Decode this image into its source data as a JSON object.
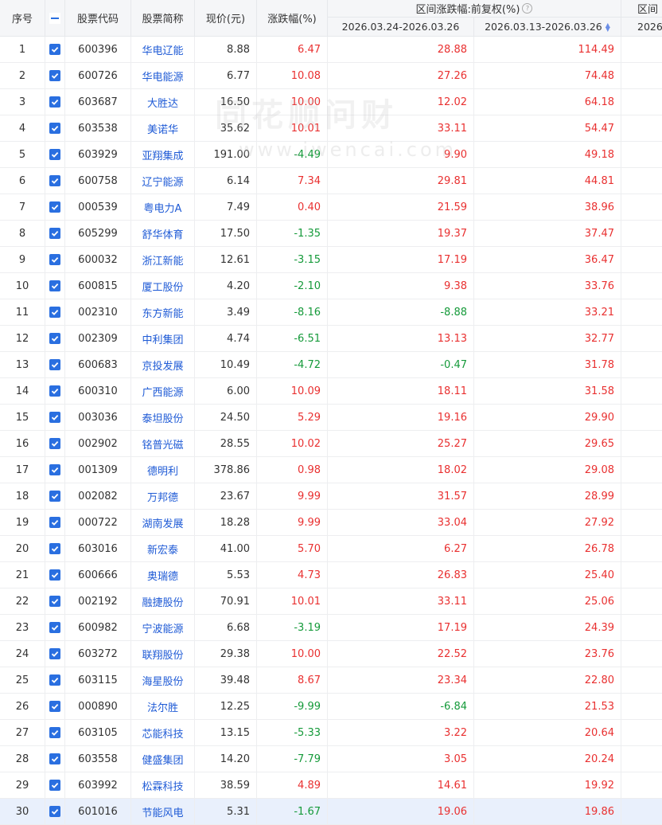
{
  "header": {
    "seq": "序号",
    "code": "股票代码",
    "name": "股票简称",
    "price": "现价(元)",
    "chg": "涨跌幅(%)",
    "group": "区间涨跌幅:前复权(%)",
    "range1": "2026.03.24-2026.03.26",
    "range2": "2026.03.13-2026.03.26",
    "group_cut": "区间",
    "range_cut": "2026"
  },
  "watermark": {
    "cn": "同花顺问财",
    "en": "www.iwencai.com"
  },
  "rows": [
    {
      "seq": "1",
      "code": "600396",
      "name": "华电辽能",
      "price": "8.88",
      "chg": "6.47",
      "r1": "28.88",
      "r2": "114.49"
    },
    {
      "seq": "2",
      "code": "600726",
      "name": "华电能源",
      "price": "6.77",
      "chg": "10.08",
      "r1": "27.26",
      "r2": "74.48"
    },
    {
      "seq": "3",
      "code": "603687",
      "name": "大胜达",
      "price": "16.50",
      "chg": "10.00",
      "r1": "12.02",
      "r2": "64.18"
    },
    {
      "seq": "4",
      "code": "603538",
      "name": "美诺华",
      "price": "35.62",
      "chg": "10.01",
      "r1": "33.11",
      "r2": "54.47"
    },
    {
      "seq": "5",
      "code": "603929",
      "name": "亚翔集成",
      "price": "191.00",
      "chg": "-4.49",
      "r1": "9.90",
      "r2": "49.18"
    },
    {
      "seq": "6",
      "code": "600758",
      "name": "辽宁能源",
      "price": "6.14",
      "chg": "7.34",
      "r1": "29.81",
      "r2": "44.81"
    },
    {
      "seq": "7",
      "code": "000539",
      "name": "粤电力A",
      "price": "7.49",
      "chg": "0.40",
      "r1": "21.59",
      "r2": "38.96"
    },
    {
      "seq": "8",
      "code": "605299",
      "name": "舒华体育",
      "price": "17.50",
      "chg": "-1.35",
      "r1": "19.37",
      "r2": "37.47"
    },
    {
      "seq": "9",
      "code": "600032",
      "name": "浙江新能",
      "price": "12.61",
      "chg": "-3.15",
      "r1": "17.19",
      "r2": "36.47"
    },
    {
      "seq": "10",
      "code": "600815",
      "name": "厦工股份",
      "price": "4.20",
      "chg": "-2.10",
      "r1": "9.38",
      "r2": "33.76"
    },
    {
      "seq": "11",
      "code": "002310",
      "name": "东方新能",
      "price": "3.49",
      "chg": "-8.16",
      "r1": "-8.88",
      "r2": "33.21"
    },
    {
      "seq": "12",
      "code": "002309",
      "name": "中利集团",
      "price": "4.74",
      "chg": "-6.51",
      "r1": "13.13",
      "r2": "32.77"
    },
    {
      "seq": "13",
      "code": "600683",
      "name": "京投发展",
      "price": "10.49",
      "chg": "-4.72",
      "r1": "-0.47",
      "r2": "31.78"
    },
    {
      "seq": "14",
      "code": "600310",
      "name": "广西能源",
      "price": "6.00",
      "chg": "10.09",
      "r1": "18.11",
      "r2": "31.58"
    },
    {
      "seq": "15",
      "code": "003036",
      "name": "泰坦股份",
      "price": "24.50",
      "chg": "5.29",
      "r1": "19.16",
      "r2": "29.90"
    },
    {
      "seq": "16",
      "code": "002902",
      "name": "铭普光磁",
      "price": "28.55",
      "chg": "10.02",
      "r1": "25.27",
      "r2": "29.65"
    },
    {
      "seq": "17",
      "code": "001309",
      "name": "德明利",
      "price": "378.86",
      "chg": "0.98",
      "r1": "18.02",
      "r2": "29.08"
    },
    {
      "seq": "18",
      "code": "002082",
      "name": "万邦德",
      "price": "23.67",
      "chg": "9.99",
      "r1": "31.57",
      "r2": "28.99"
    },
    {
      "seq": "19",
      "code": "000722",
      "name": "湖南发展",
      "price": "18.28",
      "chg": "9.99",
      "r1": "33.04",
      "r2": "27.92"
    },
    {
      "seq": "20",
      "code": "603016",
      "name": "新宏泰",
      "price": "41.00",
      "chg": "5.70",
      "r1": "6.27",
      "r2": "26.78"
    },
    {
      "seq": "21",
      "code": "600666",
      "name": "奥瑞德",
      "price": "5.53",
      "chg": "4.73",
      "r1": "26.83",
      "r2": "25.40"
    },
    {
      "seq": "22",
      "code": "002192",
      "name": "融捷股份",
      "price": "70.91",
      "chg": "10.01",
      "r1": "33.11",
      "r2": "25.06"
    },
    {
      "seq": "23",
      "code": "600982",
      "name": "宁波能源",
      "price": "6.68",
      "chg": "-3.19",
      "r1": "17.19",
      "r2": "24.39"
    },
    {
      "seq": "24",
      "code": "603272",
      "name": "联翔股份",
      "price": "29.38",
      "chg": "10.00",
      "r1": "22.52",
      "r2": "23.76"
    },
    {
      "seq": "25",
      "code": "603115",
      "name": "海星股份",
      "price": "39.48",
      "chg": "8.67",
      "r1": "23.34",
      "r2": "22.80"
    },
    {
      "seq": "26",
      "code": "000890",
      "name": "法尔胜",
      "price": "12.25",
      "chg": "-9.99",
      "r1": "-6.84",
      "r2": "21.53"
    },
    {
      "seq": "27",
      "code": "603105",
      "name": "芯能科技",
      "price": "13.15",
      "chg": "-5.33",
      "r1": "3.22",
      "r2": "20.64"
    },
    {
      "seq": "28",
      "code": "603558",
      "name": "健盛集团",
      "price": "14.20",
      "chg": "-7.79",
      "r1": "3.05",
      "r2": "20.24"
    },
    {
      "seq": "29",
      "code": "603992",
      "name": "松霖科技",
      "price": "38.59",
      "chg": "4.89",
      "r1": "14.61",
      "r2": "19.92"
    },
    {
      "seq": "30",
      "code": "601016",
      "name": "节能风电",
      "price": "5.31",
      "chg": "-1.67",
      "r1": "19.06",
      "r2": "19.86"
    }
  ],
  "colors": {
    "up": "#e93030",
    "down": "#159a3a",
    "link": "#1f5bd6",
    "check": "#2a6fe0"
  }
}
